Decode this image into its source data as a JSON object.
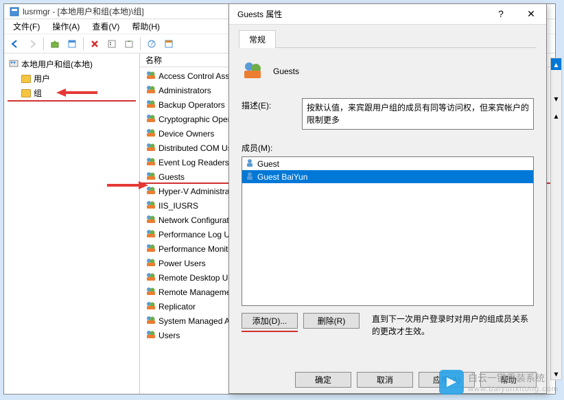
{
  "window": {
    "title": "lusrmgr - [本地用户和组(本地)\\组]"
  },
  "menu": {
    "file": "文件(F)",
    "action": "操作(A)",
    "view": "查看(V)",
    "help": "帮助(H)"
  },
  "tree": {
    "root": "本地用户和组(本地)",
    "users": "用户",
    "groups": "组"
  },
  "list": {
    "col_name": "名称",
    "items": [
      "Access Control Assistance Operators",
      "Administrators",
      "Backup Operators",
      "Cryptographic Operators",
      "Device Owners",
      "Distributed COM Users",
      "Event Log Readers",
      "Guests",
      "Hyper-V Administrators",
      "IIS_IUSRS",
      "Network Configuration Operators",
      "Performance Log Users",
      "Performance Monitor Users",
      "Power Users",
      "Remote Desktop Users",
      "Remote Management Users",
      "Replicator",
      "System Managed Accounts Group",
      "Users"
    ],
    "selected_index": 7
  },
  "dialog": {
    "title": "Guests 属性",
    "help_btn": "?",
    "tab_general": "常规",
    "group_name": "Guests",
    "desc_label": "描述(E):",
    "desc_text": "按默认值，来宾跟用户组的成员有同等访问权，但来宾帐户的限制更多",
    "members_label": "成员(M):",
    "members": [
      {
        "name": "Guest",
        "selected": false
      },
      {
        "name": "Guest BaiYun",
        "selected": true
      }
    ],
    "add_btn": "添加(D)...",
    "remove_btn": "删除(R)",
    "hint": "直到下一次用户登录时对用户的组成员关系的更改才生效。",
    "ok": "确定",
    "cancel": "取消",
    "apply": "应用(A)",
    "help": "帮助"
  },
  "watermark": {
    "brand": "白云一键重装系统",
    "url": "www.baiyunxitong.com"
  }
}
